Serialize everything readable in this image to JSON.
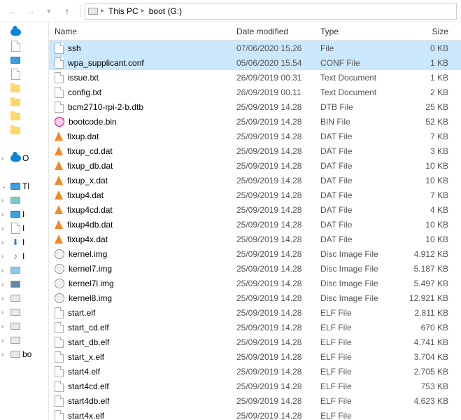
{
  "breadcrumb": {
    "root": "This PC",
    "folder": "boot (G:)"
  },
  "columns": {
    "name": "Name",
    "date": "Date modified",
    "type": "Type",
    "size": "Size"
  },
  "tree": [
    {
      "icon": "cloud",
      "label": "",
      "caret": ""
    },
    {
      "icon": "file",
      "label": "",
      "caret": ""
    },
    {
      "icon": "monitor",
      "label": "",
      "caret": ""
    },
    {
      "icon": "file",
      "label": "",
      "caret": ""
    },
    {
      "icon": "folder",
      "label": "",
      "caret": ""
    },
    {
      "icon": "folder",
      "label": "",
      "caret": ""
    },
    {
      "icon": "folder",
      "label": "",
      "caret": ""
    },
    {
      "icon": "folder",
      "label": "",
      "caret": ""
    },
    {
      "icon": "blank",
      "label": "",
      "caret": ""
    },
    {
      "icon": "cloud",
      "label": "O",
      "caret": ">"
    },
    {
      "icon": "blank",
      "label": "",
      "caret": ""
    },
    {
      "icon": "monitor",
      "label": "Tl",
      "caret": "v"
    },
    {
      "icon": "box3d",
      "label": "",
      "caret": ">"
    },
    {
      "icon": "monitor",
      "label": "I",
      "caret": ">"
    },
    {
      "icon": "file",
      "label": "I",
      "caret": ">"
    },
    {
      "icon": "arrowdn",
      "label": "I",
      "caret": ">"
    },
    {
      "icon": "music",
      "label": "I",
      "caret": ">"
    },
    {
      "icon": "picture",
      "label": "",
      "caret": ">"
    },
    {
      "icon": "video",
      "label": "",
      "caret": ">"
    },
    {
      "icon": "drive",
      "label": "",
      "caret": ">"
    },
    {
      "icon": "drive",
      "label": "",
      "caret": ">"
    },
    {
      "icon": "drive",
      "label": "",
      "caret": ">"
    },
    {
      "icon": "drive",
      "label": "",
      "caret": ">"
    },
    {
      "icon": "drive",
      "label": "bo",
      "caret": ">"
    }
  ],
  "files": [
    {
      "icon": "file",
      "name": "ssh",
      "date": "07/06/2020 15.26",
      "type": "File",
      "size": "0 KB",
      "sel": true
    },
    {
      "icon": "file",
      "name": "wpa_supplicant.conf",
      "date": "05/06/2020 15.54",
      "type": "CONF File",
      "size": "1 KB",
      "sel": true
    },
    {
      "icon": "file",
      "name": "issue.txt",
      "date": "26/09/2019 00.31",
      "type": "Text Document",
      "size": "1 KB"
    },
    {
      "icon": "file",
      "name": "config.txt",
      "date": "26/09/2019 00.11",
      "type": "Text Document",
      "size": "2 KB"
    },
    {
      "icon": "file",
      "name": "bcm2710-rpi-2-b.dtb",
      "date": "25/09/2019 14.28",
      "type": "DTB File",
      "size": "25 KB"
    },
    {
      "icon": "bin",
      "name": "bootcode.bin",
      "date": "25/09/2019 14.28",
      "type": "BIN File",
      "size": "52 KB"
    },
    {
      "icon": "vlc",
      "name": "fixup.dat",
      "date": "25/09/2019 14.28",
      "type": "DAT File",
      "size": "7 KB"
    },
    {
      "icon": "vlc",
      "name": "fixup_cd.dat",
      "date": "25/09/2019 14.28",
      "type": "DAT File",
      "size": "3 KB"
    },
    {
      "icon": "vlc",
      "name": "fixup_db.dat",
      "date": "25/09/2019 14.28",
      "type": "DAT File",
      "size": "10 KB"
    },
    {
      "icon": "vlc",
      "name": "fixup_x.dat",
      "date": "25/09/2019 14.28",
      "type": "DAT File",
      "size": "10 KB"
    },
    {
      "icon": "vlc",
      "name": "fixup4.dat",
      "date": "25/09/2019 14.28",
      "type": "DAT File",
      "size": "7 KB"
    },
    {
      "icon": "vlc",
      "name": "fixup4cd.dat",
      "date": "25/09/2019 14.28",
      "type": "DAT File",
      "size": "4 KB"
    },
    {
      "icon": "vlc",
      "name": "fixup4db.dat",
      "date": "25/09/2019 14.28",
      "type": "DAT File",
      "size": "10 KB"
    },
    {
      "icon": "vlc",
      "name": "fixup4x.dat",
      "date": "25/09/2019 14.28",
      "type": "DAT File",
      "size": "10 KB"
    },
    {
      "icon": "disc",
      "name": "kernel.img",
      "date": "25/09/2019 14.28",
      "type": "Disc Image File",
      "size": "4.912 KB"
    },
    {
      "icon": "disc",
      "name": "kernel7.img",
      "date": "25/09/2019 14.28",
      "type": "Disc Image File",
      "size": "5.187 KB"
    },
    {
      "icon": "disc",
      "name": "kernel7l.img",
      "date": "25/09/2019 14.28",
      "type": "Disc Image File",
      "size": "5.497 KB"
    },
    {
      "icon": "disc",
      "name": "kernel8.img",
      "date": "25/09/2019 14.28",
      "type": "Disc Image File",
      "size": "12.921 KB"
    },
    {
      "icon": "file",
      "name": "start.elf",
      "date": "25/09/2019 14.28",
      "type": "ELF File",
      "size": "2.811 KB"
    },
    {
      "icon": "file",
      "name": "start_cd.elf",
      "date": "25/09/2019 14.28",
      "type": "ELF File",
      "size": "670 KB"
    },
    {
      "icon": "file",
      "name": "start_db.elf",
      "date": "25/09/2019 14.28",
      "type": "ELF File",
      "size": "4.741 KB"
    },
    {
      "icon": "file",
      "name": "start_x.elf",
      "date": "25/09/2019 14.28",
      "type": "ELF File",
      "size": "3.704 KB"
    },
    {
      "icon": "file",
      "name": "start4.elf",
      "date": "25/09/2019 14.28",
      "type": "ELF File",
      "size": "2.705 KB"
    },
    {
      "icon": "file",
      "name": "start4cd.elf",
      "date": "25/09/2019 14.28",
      "type": "ELF File",
      "size": "753 KB"
    },
    {
      "icon": "file",
      "name": "start4db.elf",
      "date": "25/09/2019 14.28",
      "type": "ELF File",
      "size": "4.623 KB"
    },
    {
      "icon": "file",
      "name": "start4x.elf",
      "date": "25/09/2019 14.28",
      "type": "ELF File",
      "size": ""
    }
  ]
}
